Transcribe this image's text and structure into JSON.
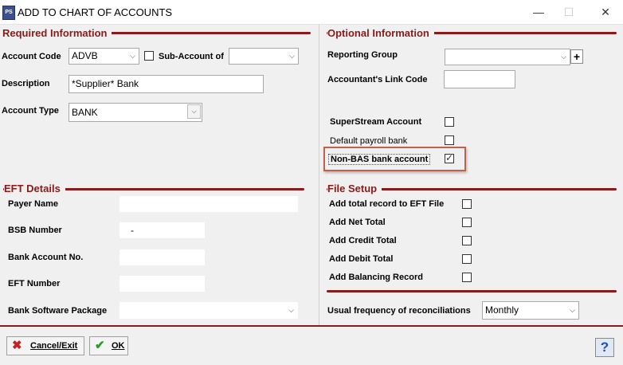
{
  "window": {
    "title": "ADD TO CHART OF ACCOUNTS",
    "app_icon_text": "PS",
    "minimize_icon": "minimize-icon",
    "maximize_icon": "maximize-icon",
    "close_icon": "close-icon"
  },
  "required": {
    "section_title": "Required Information",
    "account_code_label": "Account Code",
    "account_code_value": "ADVB",
    "sub_account_label": "Sub-Account of",
    "sub_account_checked": false,
    "sub_account_value": "",
    "description_label": "Description",
    "description_value": "*Supplier* Bank",
    "account_type_label": "Account Type",
    "account_type_value": "BANK"
  },
  "optional": {
    "section_title": "Optional Information",
    "reporting_group_label": "Reporting Group",
    "reporting_group_value": "",
    "add_group_icon": "plus-icon",
    "add_group_text": "+",
    "accountant_link_label": "Accountant's Link Code",
    "accountant_link_value": "",
    "superstream_label": "SuperStream Account",
    "superstream_checked": false,
    "default_payroll_label": "Default payroll bank",
    "default_payroll_checked": false,
    "non_bas_label": "Non-BAS bank account",
    "non_bas_checked": true
  },
  "eft": {
    "section_title": "EFT Details",
    "payer_name_label": "Payer Name",
    "payer_name_value": "",
    "bsb_label": "BSB Number",
    "bsb_value": "-",
    "bank_account_label": "Bank Account No.",
    "bank_account_value": "",
    "eft_number_label": "EFT Number",
    "eft_number_value": "",
    "software_label": "Bank Software Package",
    "software_value": ""
  },
  "file_setup": {
    "section_title": "File Setup",
    "items": [
      {
        "label": "Add total record to EFT File",
        "checked": false
      },
      {
        "label": "Add Net Total",
        "checked": false
      },
      {
        "label": "Add Credit Total",
        "checked": false
      },
      {
        "label": "Add Debit Total",
        "checked": false
      },
      {
        "label": "Add Balancing Record",
        "checked": false
      }
    ],
    "frequency_label": "Usual frequency of reconciliations",
    "frequency_value": "Monthly"
  },
  "footer": {
    "cancel_label": "Cancel/Exit",
    "cancel_icon": "red-x-icon",
    "ok_label": "OK",
    "ok_icon": "green-check-icon",
    "help_icon": "help-question-icon",
    "help_text": "?"
  },
  "colors": {
    "section_accent": "#8b1a1a",
    "highlight_border": "#c0614a",
    "background": "#f0f0f0"
  }
}
